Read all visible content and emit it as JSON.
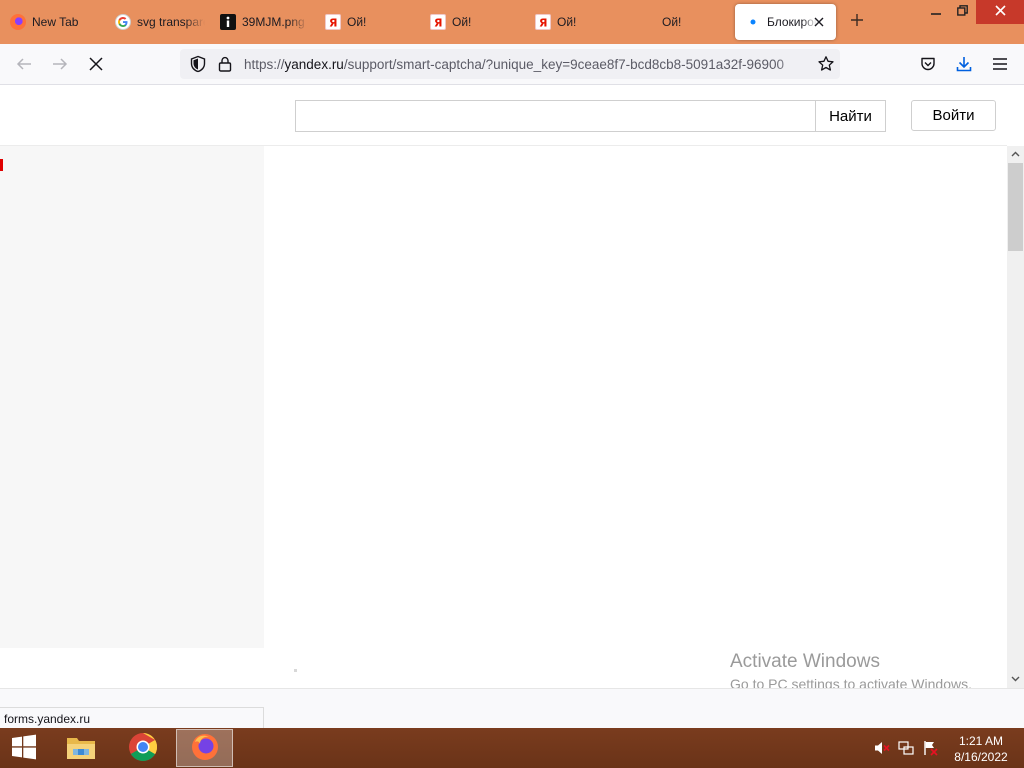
{
  "browser": {
    "tabs": [
      {
        "title": "New Tab",
        "icon": "firefox-icon",
        "active": false
      },
      {
        "title": "svg transparent",
        "icon": "google-icon",
        "active": false
      },
      {
        "title": "39MJM.png",
        "icon": "info-icon",
        "active": false
      },
      {
        "title": "Ой!",
        "icon": "yandex-icon",
        "active": false
      },
      {
        "title": "Ой!",
        "icon": "yandex-icon",
        "active": false
      },
      {
        "title": "Ой!",
        "icon": "yandex-icon",
        "active": false
      },
      {
        "title": "Ой!",
        "icon": "none",
        "active": false
      },
      {
        "title": "Блокировка",
        "icon": "loading-dot-icon",
        "active": true
      }
    ],
    "new_tab_icon": "plus-icon",
    "window_controls": [
      "minimize-icon",
      "restore-icon",
      "close-icon"
    ],
    "url": {
      "prefix": "https://",
      "domain": "yandex.ru",
      "path": "/support/smart-captcha/?unique_key=9ceae8f7-bcd8cb8-5091a32f-96900"
    },
    "status_url": "forms.yandex.ru",
    "accent_color": "#e8905e"
  },
  "page": {
    "search_button": "Найти",
    "search_value": "",
    "login_button": "Войти",
    "marker_color": "#e00000"
  },
  "watermark": {
    "title": "Activate Windows",
    "subtitle": "Go to PC settings to activate Windows."
  },
  "taskbar": {
    "apps": [
      "windows-start-icon",
      "file-explorer-icon",
      "chrome-icon",
      "firefox-icon"
    ],
    "time": "1:21 AM",
    "date": "8/16/2022"
  }
}
